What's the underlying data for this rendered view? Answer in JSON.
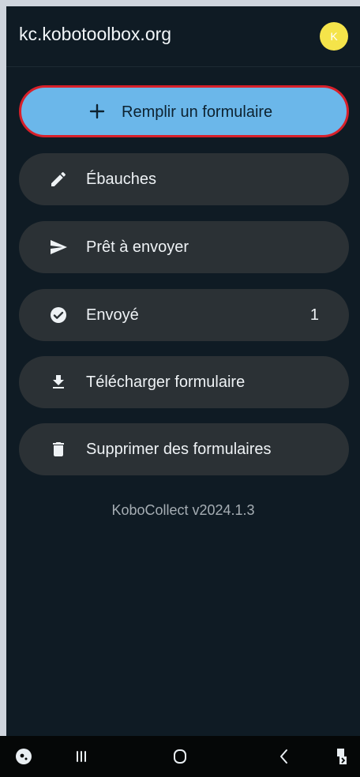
{
  "app": {
    "title": "kc.kobotoolbox.org",
    "avatar_initial": "K"
  },
  "menu": {
    "fill_form_label": "Remplir un formulaire",
    "drafts_label": "Ébauches",
    "ready_to_send_label": "Prêt à envoyer",
    "sent_label": "Envoyé",
    "sent_count": "1",
    "download_form_label": "Télécharger formulaire",
    "delete_forms_label": "Supprimer des formulaires"
  },
  "footer": {
    "version": "KoboCollect v2024.1.3"
  },
  "icons": {
    "fill": "plus-icon",
    "drafts": "pencil-icon",
    "ready": "send-icon",
    "sent": "check-circle-icon",
    "download": "download-icon",
    "delete": "trash-icon"
  },
  "colors": {
    "background": "#0f1b24",
    "button": "#2b3135",
    "primary_button": "#6bb7ea",
    "highlight_border": "#d8202a",
    "avatar": "#f5e44a"
  }
}
